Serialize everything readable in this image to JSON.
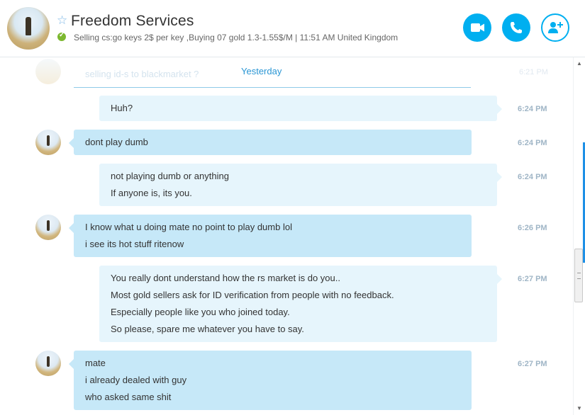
{
  "header": {
    "contact_name": "Freedom Services",
    "status": "Selling cs:go keys 2$ per key ,Buying 07 gold 1.3-1.55$/M  |  11:51 AM United Kingdom"
  },
  "chat": {
    "faded_message": "selling id-s to blackmarket ?",
    "date_separator": "Yesterday",
    "messages": [
      {
        "direction": "out",
        "time": "6:24 PM",
        "lines": [
          "Huh?"
        ]
      },
      {
        "direction": "in",
        "time": "6:24 PM",
        "lines": [
          "dont play dumb"
        ]
      },
      {
        "direction": "out",
        "time": "6:24 PM",
        "lines": [
          "not playing dumb or anything",
          "If anyone is, its you."
        ]
      },
      {
        "direction": "in",
        "time": "6:26 PM",
        "lines": [
          "I know what u doing mate no point to play dumb lol",
          "i see its hot stuff ritenow"
        ]
      },
      {
        "direction": "out",
        "time": "6:27 PM",
        "lines": [
          "You really dont understand how the rs market is do you..",
          "Most gold sellers ask for ID verification from people with no feedback.",
          "Especially people like you who joined today.",
          "So please, spare me whatever you have to say."
        ]
      },
      {
        "direction": "in",
        "time": "6:27 PM",
        "lines": [
          "mate",
          "i already dealed with guy",
          "who asked same shit"
        ]
      }
    ]
  },
  "colors": {
    "accent": "#00aff0",
    "outgoing_bubble": "#e6f5fc",
    "incoming_bubble": "#c6e8f8",
    "online_status": "#7cb82f"
  },
  "icons": {
    "video": "video-camera-icon",
    "call": "phone-icon",
    "add": "add-person-icon",
    "favorite": "star-outline-icon",
    "status": "online-check-icon"
  }
}
